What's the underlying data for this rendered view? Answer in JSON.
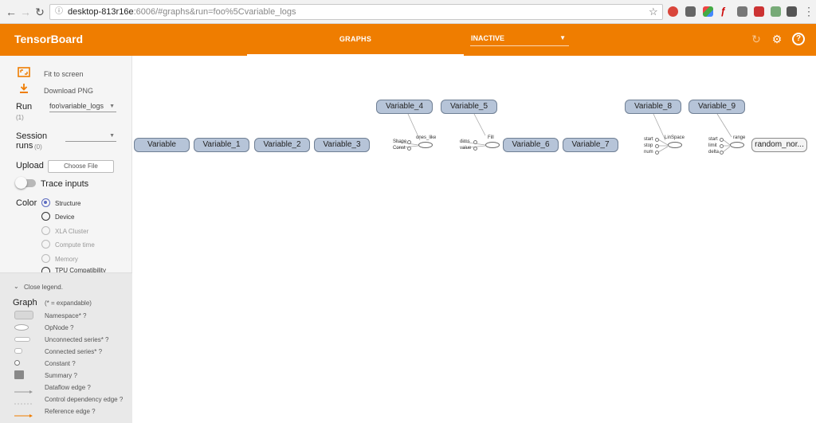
{
  "browser": {
    "url_host": "desktop-813r16e",
    "url_rest": ":6006/#graphs&run=foo%5Cvariable_logs"
  },
  "header": {
    "title": "TensorBoard",
    "tab_graphs": "GRAPHS",
    "status_dropdown": "INACTIVE"
  },
  "sidebar": {
    "fit_to_screen": "Fit to screen",
    "download_png": "Download PNG",
    "run_label": "Run",
    "run_count": "(1)",
    "run_value": "foo\\variable_logs",
    "session_runs_label_1": "Session",
    "session_runs_label_2": "runs",
    "session_runs_count": "(0)",
    "upload_label": "Upload",
    "choose_file": "Choose File",
    "trace_inputs": "Trace inputs",
    "color_label": "Color",
    "color_options": [
      "Structure",
      "Device",
      "XLA Cluster",
      "Compute time",
      "Memory",
      "TPU Compatibility"
    ],
    "color_selected": "Structure"
  },
  "legend": {
    "close_legend": "Close legend.",
    "graph_label": "Graph",
    "expandable_note": "(* = expandable)",
    "items": [
      "Namespace* ?",
      "OpNode ?",
      "Unconnected series* ?",
      "Connected series* ?",
      "Constant ?",
      "Summary ?",
      "Dataflow edge ?",
      "Control dependency edge ?",
      "Reference edge ?"
    ]
  },
  "graph": {
    "nodes": [
      "Variable",
      "Variable_1",
      "Variable_2",
      "Variable_3",
      "Variable_4",
      "Variable_5",
      "Variable_6",
      "Variable_7",
      "Variable_8",
      "Variable_9",
      "random_nor..."
    ],
    "ops": {
      "ones_like": {
        "name": "ones_like",
        "inputs": [
          "Shape",
          "Const"
        ]
      },
      "fill": {
        "name": "Fill",
        "inputs": [
          "dims",
          "value"
        ]
      },
      "linspace": {
        "name": "LinSpace",
        "inputs": [
          "start",
          "stop",
          "num"
        ]
      },
      "range": {
        "name": "range",
        "inputs": [
          "start",
          "limit",
          "delta"
        ]
      }
    }
  },
  "colors": {
    "header": "#ef7d00",
    "node_fill": "#b6c4d8",
    "node_border": "#6f7f94",
    "radio_selected": "#5c6bc0"
  }
}
